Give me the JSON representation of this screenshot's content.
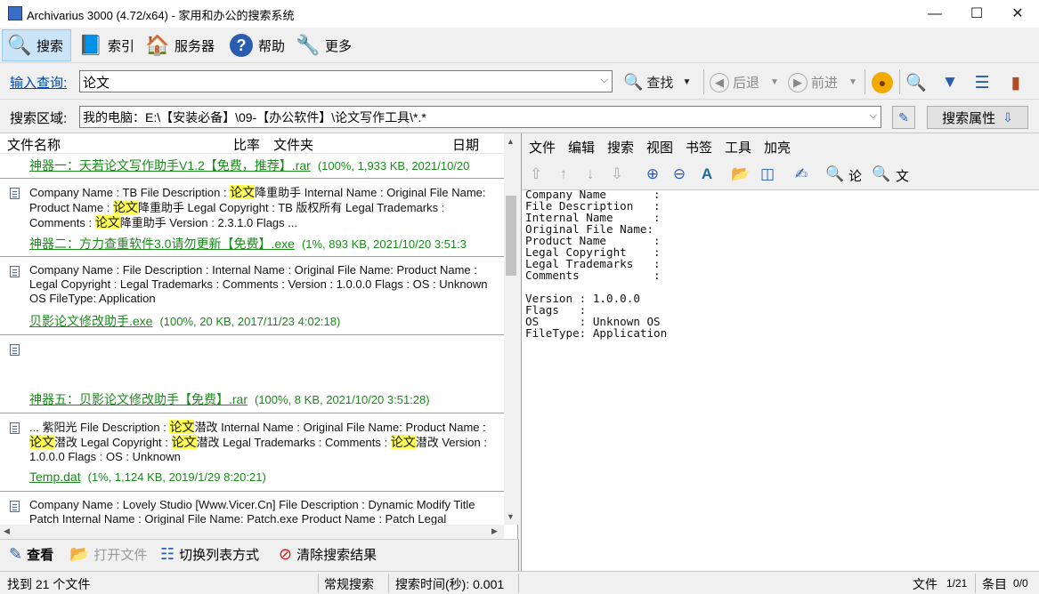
{
  "window": {
    "title": "Archivarius 3000 (4.72/x64) - 家用和办公的搜索系统",
    "minimize": "—",
    "maximize": "☐",
    "close": "✕"
  },
  "toolbar": {
    "search": "搜索",
    "index": "索引",
    "server": "服务器",
    "help": "帮助",
    "more": "更多"
  },
  "query": {
    "label": "输入查询:",
    "value": "论文",
    "find": "查找",
    "back": "后退",
    "forward": "前进"
  },
  "area": {
    "label": "搜索区域:",
    "value": "我的电脑：E:\\【安装必备】\\09-【办公软件】\\论文写作工具\\*.*",
    "props": "搜索属性"
  },
  "columns": {
    "name": "文件名称",
    "ratio": "比率",
    "folder": "文件夹",
    "date": "日期"
  },
  "results": [
    {
      "file": "神器一：天若论文写作助手V1.2【免费，推荐】.rar",
      "meta": "(100%, 1,933 KB, 2021/10/20"
    },
    {
      "desc": [
        {
          "t": "Company Name : TB File Description : "
        },
        {
          "t": "论文",
          "h": true
        },
        {
          "t": "降重助手 Internal Name : Original File Name: Product Name : "
        },
        {
          "t": "论文",
          "h": true
        },
        {
          "t": "降重助手 Legal Copyright : TB 版权所有 Legal Trademarks : Comments : "
        },
        {
          "t": "论文",
          "h": true
        },
        {
          "t": "降重助手 Version : 2.3.1.0 Flags  ..."
        }
      ],
      "file": "神器二：方力查重软件3.0请勿更新【免费】.exe",
      "meta": "(1%, 893 KB, 2021/10/20 3:51:3"
    },
    {
      "desc": [
        {
          "t": "Company Name : File Description : Internal Name : Original File Name: Product Name : Legal Copyright : Legal Trademarks : Comments : Version : 1.0.0.0 Flags : OS : Unknown OS FileType: Application"
        }
      ],
      "file": "贝影论文修改助手.exe",
      "meta": "(100%, 20 KB, 2017/11/23 4:02:18)"
    },
    {
      "desc": [],
      "file": "神器五：贝影论文修改助手【免费】.rar",
      "meta": "(100%, 8 KB, 2021/10/20 3:51:28)"
    },
    {
      "desc": [
        {
          "t": "...  紫阳光 File Description : "
        },
        {
          "t": "论文",
          "h": true
        },
        {
          "t": "潜改 Internal Name : Original File Name: Product Name : "
        },
        {
          "t": "论文",
          "h": true
        },
        {
          "t": "潜改 Legal Copyright : "
        },
        {
          "t": "论文",
          "h": true
        },
        {
          "t": "潜改 Legal Trademarks : Comments : "
        },
        {
          "t": "论文",
          "h": true
        },
        {
          "t": "潜改 Version : 1.0.0.0 Flags : OS : Unknown"
        }
      ],
      "file": "Temp.dat",
      "meta": "(1%, 1,124 KB, 2019/1/29 8:20:21)"
    },
    {
      "desc": [
        {
          "t": "Company Name : Lovely Studio [Www.Vicer.Cn] File Description : Dynamic Modify Title Patch Internal Name : Original File Name: Patch.exe Product Name : Patch Legal"
        }
      ]
    }
  ],
  "bottom": {
    "view": "查看",
    "open": "打开文件",
    "switch": "切换列表方式",
    "clear": "清除搜索结果"
  },
  "status": {
    "found": "找到 21 个文件",
    "mode": "常规搜索",
    "time": "搜索时间(秒): 0.001",
    "file_label": "文件",
    "file_val": "1/21",
    "entry_label": "条目",
    "entry_val": "0/0"
  },
  "viewer_menu": [
    "文件",
    "编辑",
    "搜索",
    "视图",
    "书签",
    "工具",
    "加亮"
  ],
  "viewer_tool": {
    "word1": "论",
    "word2": "文"
  },
  "viewer_text": "Company Name       :\nFile Description   :\nInternal Name      :\nOriginal File Name:\nProduct Name       :\nLegal Copyright    :\nLegal Trademarks   :\nComments           :\n\nVersion : 1.0.0.0\nFlags   :\nOS      : Unknown OS\nFileType: Application",
  "colors": {
    "green": "#1a8a1a",
    "highlight": "#ffff55",
    "link": "#0047b3"
  }
}
